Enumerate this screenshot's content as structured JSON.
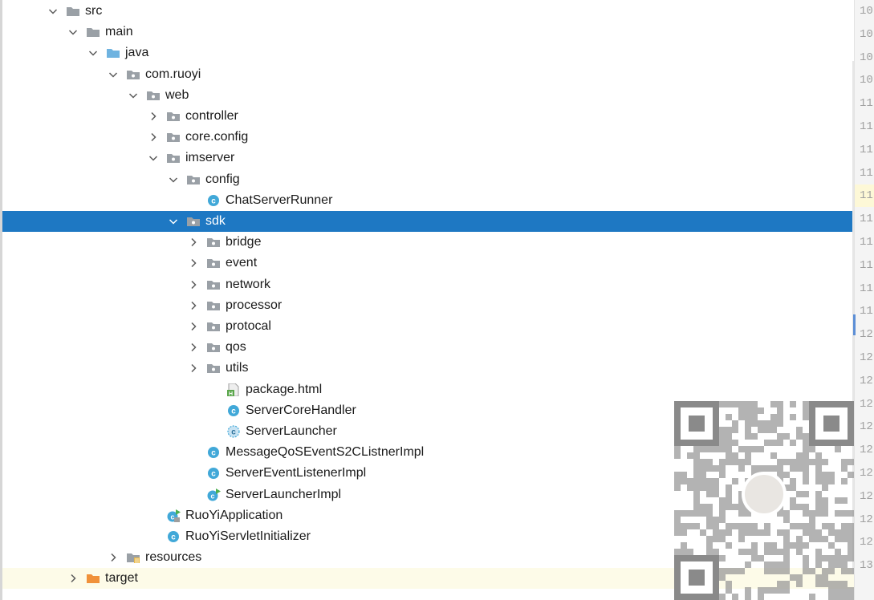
{
  "tree": {
    "items": [
      {
        "label": "src",
        "icon": "folder-gray-icon",
        "level": 0,
        "expanded": true
      },
      {
        "label": "main",
        "icon": "folder-gray-icon",
        "level": 1,
        "expanded": true
      },
      {
        "label": "java",
        "icon": "folder-blue-icon",
        "level": 2,
        "expanded": true
      },
      {
        "label": "com.ruoyi",
        "icon": "package-icon",
        "level": 3,
        "expanded": true
      },
      {
        "label": "web",
        "icon": "package-icon",
        "level": 4,
        "expanded": true
      },
      {
        "label": "controller",
        "icon": "package-icon",
        "level": 5,
        "expanded": false
      },
      {
        "label": "core.config",
        "icon": "package-icon",
        "level": 5,
        "expanded": false
      },
      {
        "label": "imserver",
        "icon": "package-icon",
        "level": 5,
        "expanded": true
      },
      {
        "label": "config",
        "icon": "package-icon",
        "level": 6,
        "expanded": true
      },
      {
        "label": "ChatServerRunner",
        "icon": "class-icon",
        "level": 7,
        "expanded": null
      },
      {
        "label": "sdk",
        "icon": "package-icon",
        "level": 6,
        "expanded": true,
        "selected": true
      },
      {
        "label": "bridge",
        "icon": "package-icon",
        "level": 7,
        "expanded": false
      },
      {
        "label": "event",
        "icon": "package-icon",
        "level": 7,
        "expanded": false
      },
      {
        "label": "network",
        "icon": "package-icon",
        "level": 7,
        "expanded": false
      },
      {
        "label": "processor",
        "icon": "package-icon",
        "level": 7,
        "expanded": false
      },
      {
        "label": "protocal",
        "icon": "package-icon",
        "level": 7,
        "expanded": false
      },
      {
        "label": "qos",
        "icon": "package-icon",
        "level": 7,
        "expanded": false
      },
      {
        "label": "utils",
        "icon": "package-icon",
        "level": 7,
        "expanded": false
      },
      {
        "label": "package.html",
        "icon": "html-file-icon",
        "level": 8,
        "expanded": null
      },
      {
        "label": "ServerCoreHandler",
        "icon": "class-icon",
        "level": 8,
        "expanded": null
      },
      {
        "label": "ServerLauncher",
        "icon": "abstract-class-icon",
        "level": 8,
        "expanded": null
      },
      {
        "label": "MessageQoSEventS2CListnerImpl",
        "icon": "class-icon",
        "level": 7,
        "expanded": null
      },
      {
        "label": "ServerEventListenerImpl",
        "icon": "class-icon",
        "level": 7,
        "expanded": null
      },
      {
        "label": "ServerLauncherImpl",
        "icon": "runnable-class-icon",
        "level": 7,
        "expanded": null
      },
      {
        "label": "RuoYiApplication",
        "icon": "spring-boot-class-icon",
        "level": 5,
        "expanded": null
      },
      {
        "label": "RuoYiServletInitializer",
        "icon": "class-icon",
        "level": 5,
        "expanded": null
      },
      {
        "label": "resources",
        "icon": "folder-resources-icon",
        "level": 3,
        "expanded": false
      },
      {
        "label": "target",
        "icon": "folder-orange-icon",
        "level": 1,
        "expanded": false,
        "highlighted": true
      }
    ]
  },
  "gutter": {
    "line_numbers": [
      "10",
      "10",
      "10",
      "10",
      "11",
      "11",
      "11",
      "11",
      "11",
      "11",
      "11",
      "11",
      "11",
      "11",
      "12",
      "12",
      "12",
      "12",
      "12",
      "12",
      "12",
      "12",
      "12",
      "12",
      "13"
    ],
    "current_line_index": 8
  },
  "colors": {
    "selection": "#1e78c3",
    "folder_gray": "#9aa0a6",
    "folder_blue": "#6fb3e0",
    "folder_orange": "#f0913a",
    "class_badge": "#41a8d8"
  }
}
